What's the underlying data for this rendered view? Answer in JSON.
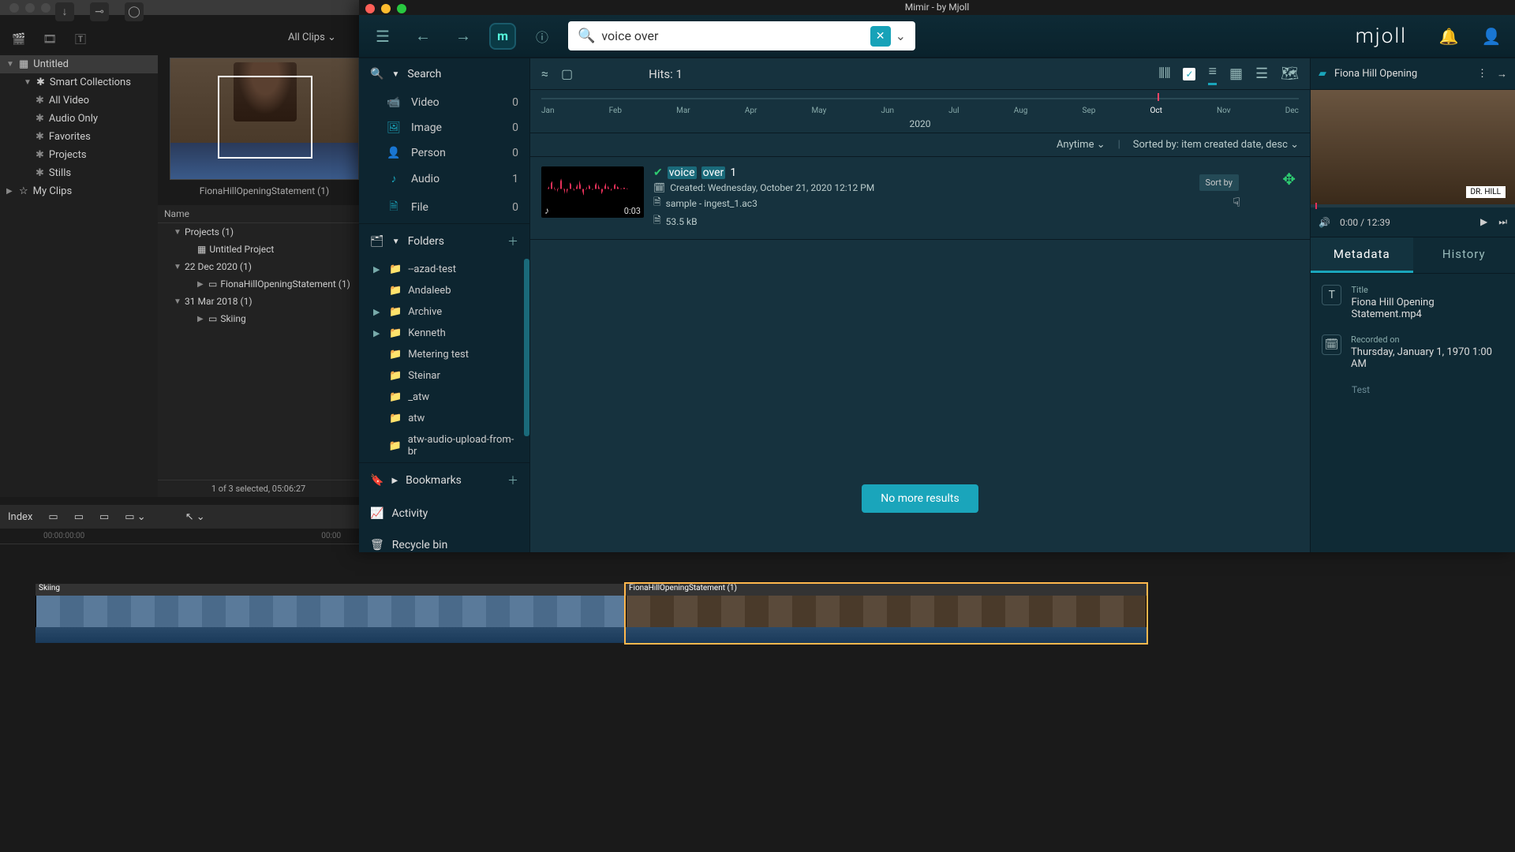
{
  "mac_title": "Mimir - by Mjoll",
  "nle": {
    "all_clips": "All Clips",
    "sidebar": {
      "untitled": "Untitled",
      "smart": "Smart Collections",
      "all_video": "All Video",
      "audio_only": "Audio Only",
      "favorites": "Favorites",
      "projects": "Projects",
      "stills": "Stills",
      "my_clips": "My Clips"
    },
    "thumb_name": "FionaHillOpeningStatement (1)",
    "name_header": "Name",
    "projects_row": "Projects  (1)",
    "untitled_project": "Untitled Project",
    "date1": "22 Dec 2020  (1)",
    "fiona_row": "FionaHillOpeningStatement (1)",
    "date2": "31 Mar 2018  (1)",
    "skiing": "Skiing",
    "status": "1 of 3 selected, 05:06:27",
    "index": "Index",
    "timecode1": "00:00:00:00",
    "timecode2": "00:00",
    "clip1_name": "Skiing",
    "clip2_name": "FionaHillOpeningStatement (1)"
  },
  "mimir": {
    "brand": "mjoll",
    "search_value": "voice over",
    "left": {
      "search": "Search",
      "folders": "Folders",
      "bookmarks": "Bookmarks",
      "activity": "Activity",
      "recycle": "Recycle bin",
      "facets": [
        {
          "icon": "videocam",
          "label": "Video",
          "count": "0"
        },
        {
          "icon": "image",
          "label": "Image",
          "count": "0"
        },
        {
          "icon": "person",
          "label": "Person",
          "count": "0"
        },
        {
          "icon": "music",
          "label": "Audio",
          "count": "1"
        },
        {
          "icon": "file",
          "label": "File",
          "count": "0"
        }
      ],
      "folders_list": [
        {
          "name": "--azad-test",
          "expandable": true
        },
        {
          "name": "Andaleeb",
          "expandable": false
        },
        {
          "name": "Archive",
          "expandable": true
        },
        {
          "name": "Kenneth",
          "expandable": true
        },
        {
          "name": "Metering test",
          "expandable": false
        },
        {
          "name": "Steinar",
          "expandable": false
        },
        {
          "name": "_atw",
          "expandable": false
        },
        {
          "name": "atw",
          "expandable": false
        },
        {
          "name": "atw-audio-upload-from-br",
          "expandable": false
        }
      ]
    },
    "center": {
      "hits": "Hits: 1",
      "months": [
        "Jan",
        "Feb",
        "Mar",
        "Apr",
        "May",
        "Jun",
        "Jul",
        "Aug",
        "Sep",
        "Oct",
        "Nov",
        "Dec"
      ],
      "year": "2020",
      "anytime": "Anytime",
      "sorted": "Sorted by: item created date, desc",
      "sortby_tip": "Sort by",
      "result": {
        "title_pre": "voice",
        "title_post": "over",
        "title_num": "1",
        "created": "Created: Wednesday, October 21, 2020 12:12 PM",
        "file": "sample - ingest_1.ac3",
        "size": "53.5 kB",
        "duration": "0:03"
      },
      "no_more": "No more results"
    },
    "right": {
      "title": "Fiona Hill Opening",
      "name_label": "DR. HILL",
      "time": "0:00 / 12:39",
      "tab_meta": "Metadata",
      "tab_history": "History",
      "meta_title_label": "Title",
      "meta_title_val": "Fiona Hill Opening Statement.mp4",
      "meta_rec_label": "Recorded on",
      "meta_rec_val": "Thursday, January 1, 1970 1:00 AM",
      "test": "Test"
    }
  }
}
